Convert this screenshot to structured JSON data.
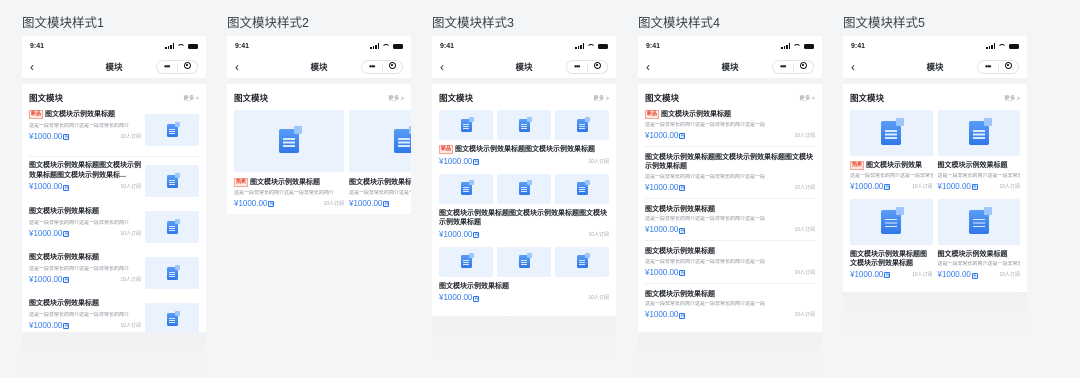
{
  "status_time": "9:41",
  "nav_title": "模块",
  "section_title": "图文模块",
  "more": "更多 >",
  "tag_new": "新品",
  "tag_hot": "热卖",
  "desc_a": "这是一段非常长的简介这是一段非常长的简介",
  "desc_b": "这是一段非常长的简介这是一段非常长的简介",
  "price": "¥1000.00",
  "price_icon": "券",
  "count": "10人订阅",
  "styles": [
    {
      "name": "图文模块样式1"
    },
    {
      "name": "图文模块样式2"
    },
    {
      "name": "图文模块样式3"
    },
    {
      "name": "图文模块样式4"
    },
    {
      "name": "图文模块样式5"
    }
  ],
  "titles": {
    "short": "图文模块示例效果标题",
    "long": "图文模块示例效果标题图文模块示例效果标题图文模块示例效果标题",
    "s1_long": "图文模块示例效果标题图文模块示例效果标题图文模块示例效果标...",
    "s2_a": "图文模块示例效果标题",
    "s2_b": "图文模块示例效果标",
    "s3_first": "图文模块示例效果标题图文模块示例效果标题",
    "s3_second": "图文模块示例效果标题图文模块示例效果标题图文模块示例效果标题",
    "s4_second": "图文模块示例效果标题图文模块示例效果标题图文模块示例效果标题",
    "s5_a": "图文模块示例效果",
    "s5_b": "图文模块示例效果标题",
    "s5_c": "图文模块示例效果标题图文模块示例效果标题",
    "s5_d": "图文模块示例效果标题"
  },
  "descs": {
    "s1": "这是一段非常长的简介这是一段非常长的简介",
    "s2": "这是一段非常长的简介这是一段非常长的简介",
    "s4": "这是一段非常长的简介这是一段非常长的简介这是一段",
    "s5": "这是一段非常长的简介这是一段非常长的简介"
  },
  "colors": {
    "accent": "#2f78ea",
    "tag_red": "#e8432a",
    "thumb_bg": "#eaf3fd"
  }
}
